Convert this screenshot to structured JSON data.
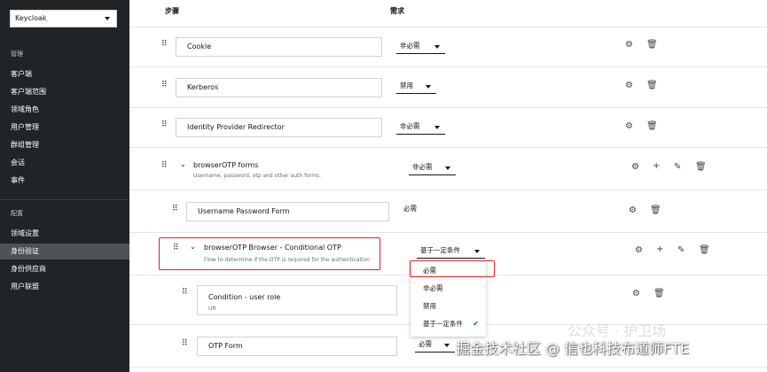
{
  "sidebar": {
    "realm": "Keycloak",
    "section_manage": "管理",
    "manage_items": [
      "客户端",
      "客户端范围",
      "领域角色",
      "用户管理",
      "群组管理",
      "会话",
      "事件"
    ],
    "section_config": "配置",
    "config_items": [
      "领域设置",
      "身份验证",
      "身份供应商",
      "用户联盟"
    ],
    "active_item": "身份验证"
  },
  "table": {
    "col_steps": "步骤",
    "col_requirement": "需求"
  },
  "rows": {
    "cookie": {
      "name": "Cookie",
      "requirement": "非必需"
    },
    "kerberos": {
      "name": "Kerberos",
      "requirement": "禁用"
    },
    "idp": {
      "name": "Identity Provider Redirector",
      "requirement": "非必需"
    },
    "forms": {
      "name": "browserOTP forms",
      "description": "Username, password, otp and other auth forms.",
      "requirement": "非必需"
    },
    "upf": {
      "name": "Username Password Form",
      "requirement": "必需"
    },
    "cond": {
      "name": "browserOTP Browser - Conditional OTP",
      "description": "Flow to determine if the OTP is required for the authentication",
      "requirement": "基于一定条件"
    },
    "role": {
      "name": "Condition - user role",
      "alias": "UR"
    },
    "otp": {
      "name": "OTP Form",
      "requirement": "必需"
    }
  },
  "dropdown_menu": {
    "options": [
      "必需",
      "非必需",
      "禁用",
      "基于一定条件"
    ],
    "highlighted": "必需",
    "selected": "基于一定条件"
  },
  "watermark": {
    "light": "公众号 · 护卫场",
    "main": "掘金技术社区 @ 信也科技布道师FTE"
  },
  "colors": {
    "sidebar_bg": "#212427",
    "active_bg": "#4f5255",
    "annotation_red": "#e02020",
    "check_blue": "#0066cc"
  }
}
